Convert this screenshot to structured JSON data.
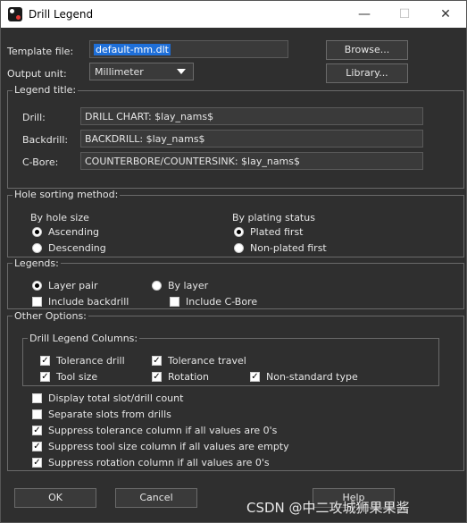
{
  "window": {
    "title": "Drill Legend",
    "minimize_glyph": "—",
    "maximize_glyph": "☐",
    "close_glyph": "✕"
  },
  "template_file": {
    "label": "Template file:",
    "value": "default-mm.dlt",
    "browse_label": "Browse..."
  },
  "output_unit": {
    "label": "Output unit:",
    "value": "Millimeter",
    "library_label": "Library..."
  },
  "legend_title": {
    "group_label": "Legend title:",
    "drill_label": "Drill:",
    "drill_value": "DRILL CHART: $lay_nams$",
    "backdrill_label": "Backdrill:",
    "backdrill_value": "BACKDRILL: $lay_nams$",
    "cbore_label": "C-Bore:",
    "cbore_value": "COUNTERBORE/COUNTERSINK: $lay_nams$"
  },
  "hole_sorting": {
    "group_label": "Hole sorting method:",
    "by_size_label": "By hole size",
    "ascending": "Ascending",
    "descending": "Descending",
    "by_plating_label": "By plating status",
    "plated_first": "Plated first",
    "nonplated_first": "Non-plated first",
    "size_selected": "Ascending",
    "plating_selected": "Plated first"
  },
  "legends": {
    "group_label": "Legends:",
    "layer_pair": "Layer pair",
    "by_layer": "By layer",
    "include_backdrill": "Include backdrill",
    "include_cbore": "Include C-Bore",
    "selected": "Layer pair",
    "include_backdrill_checked": false,
    "include_cbore_checked": false
  },
  "other_options": {
    "group_label": "Other Options:",
    "columns_group_label": "Drill Legend Columns:",
    "tolerance_drill": "Tolerance drill",
    "tolerance_travel": "Tolerance travel",
    "tool_size": "Tool size",
    "rotation": "Rotation",
    "nonstandard_type": "Non-standard type",
    "display_total": "Display total slot/drill count",
    "separate_slots": "Separate slots from drills",
    "suppress_tolerance": "Suppress tolerance column if all values are 0's",
    "suppress_tool_size": "Suppress tool size column if all values are empty",
    "suppress_rotation": "Suppress rotation column if all values are 0's",
    "check_glyph": "✓"
  },
  "buttons": {
    "ok": "OK",
    "cancel": "Cancel",
    "help": "Help"
  },
  "watermark": "CSDN @中二攻城狮果果酱"
}
